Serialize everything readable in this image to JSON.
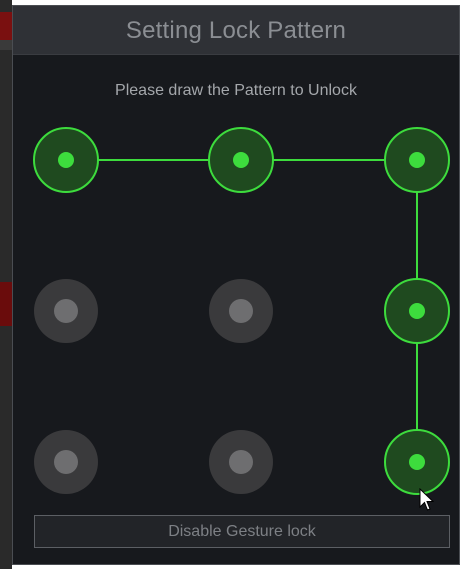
{
  "dialog": {
    "title": "Setting Lock Pattern",
    "instruction": "Please draw the Pattern to Unlock",
    "disable_button_label": "Disable Gesture lock"
  },
  "pattern": {
    "active_color": "#3ddc3d",
    "inactive_color": "#3a3a3c",
    "nodes": [
      {
        "id": 1,
        "selected": true
      },
      {
        "id": 2,
        "selected": true
      },
      {
        "id": 3,
        "selected": true
      },
      {
        "id": 4,
        "selected": false
      },
      {
        "id": 5,
        "selected": false
      },
      {
        "id": 6,
        "selected": true
      },
      {
        "id": 7,
        "selected": false
      },
      {
        "id": 8,
        "selected": false
      },
      {
        "id": 9,
        "selected": true
      }
    ],
    "path": [
      1,
      2,
      3,
      6,
      9
    ]
  }
}
